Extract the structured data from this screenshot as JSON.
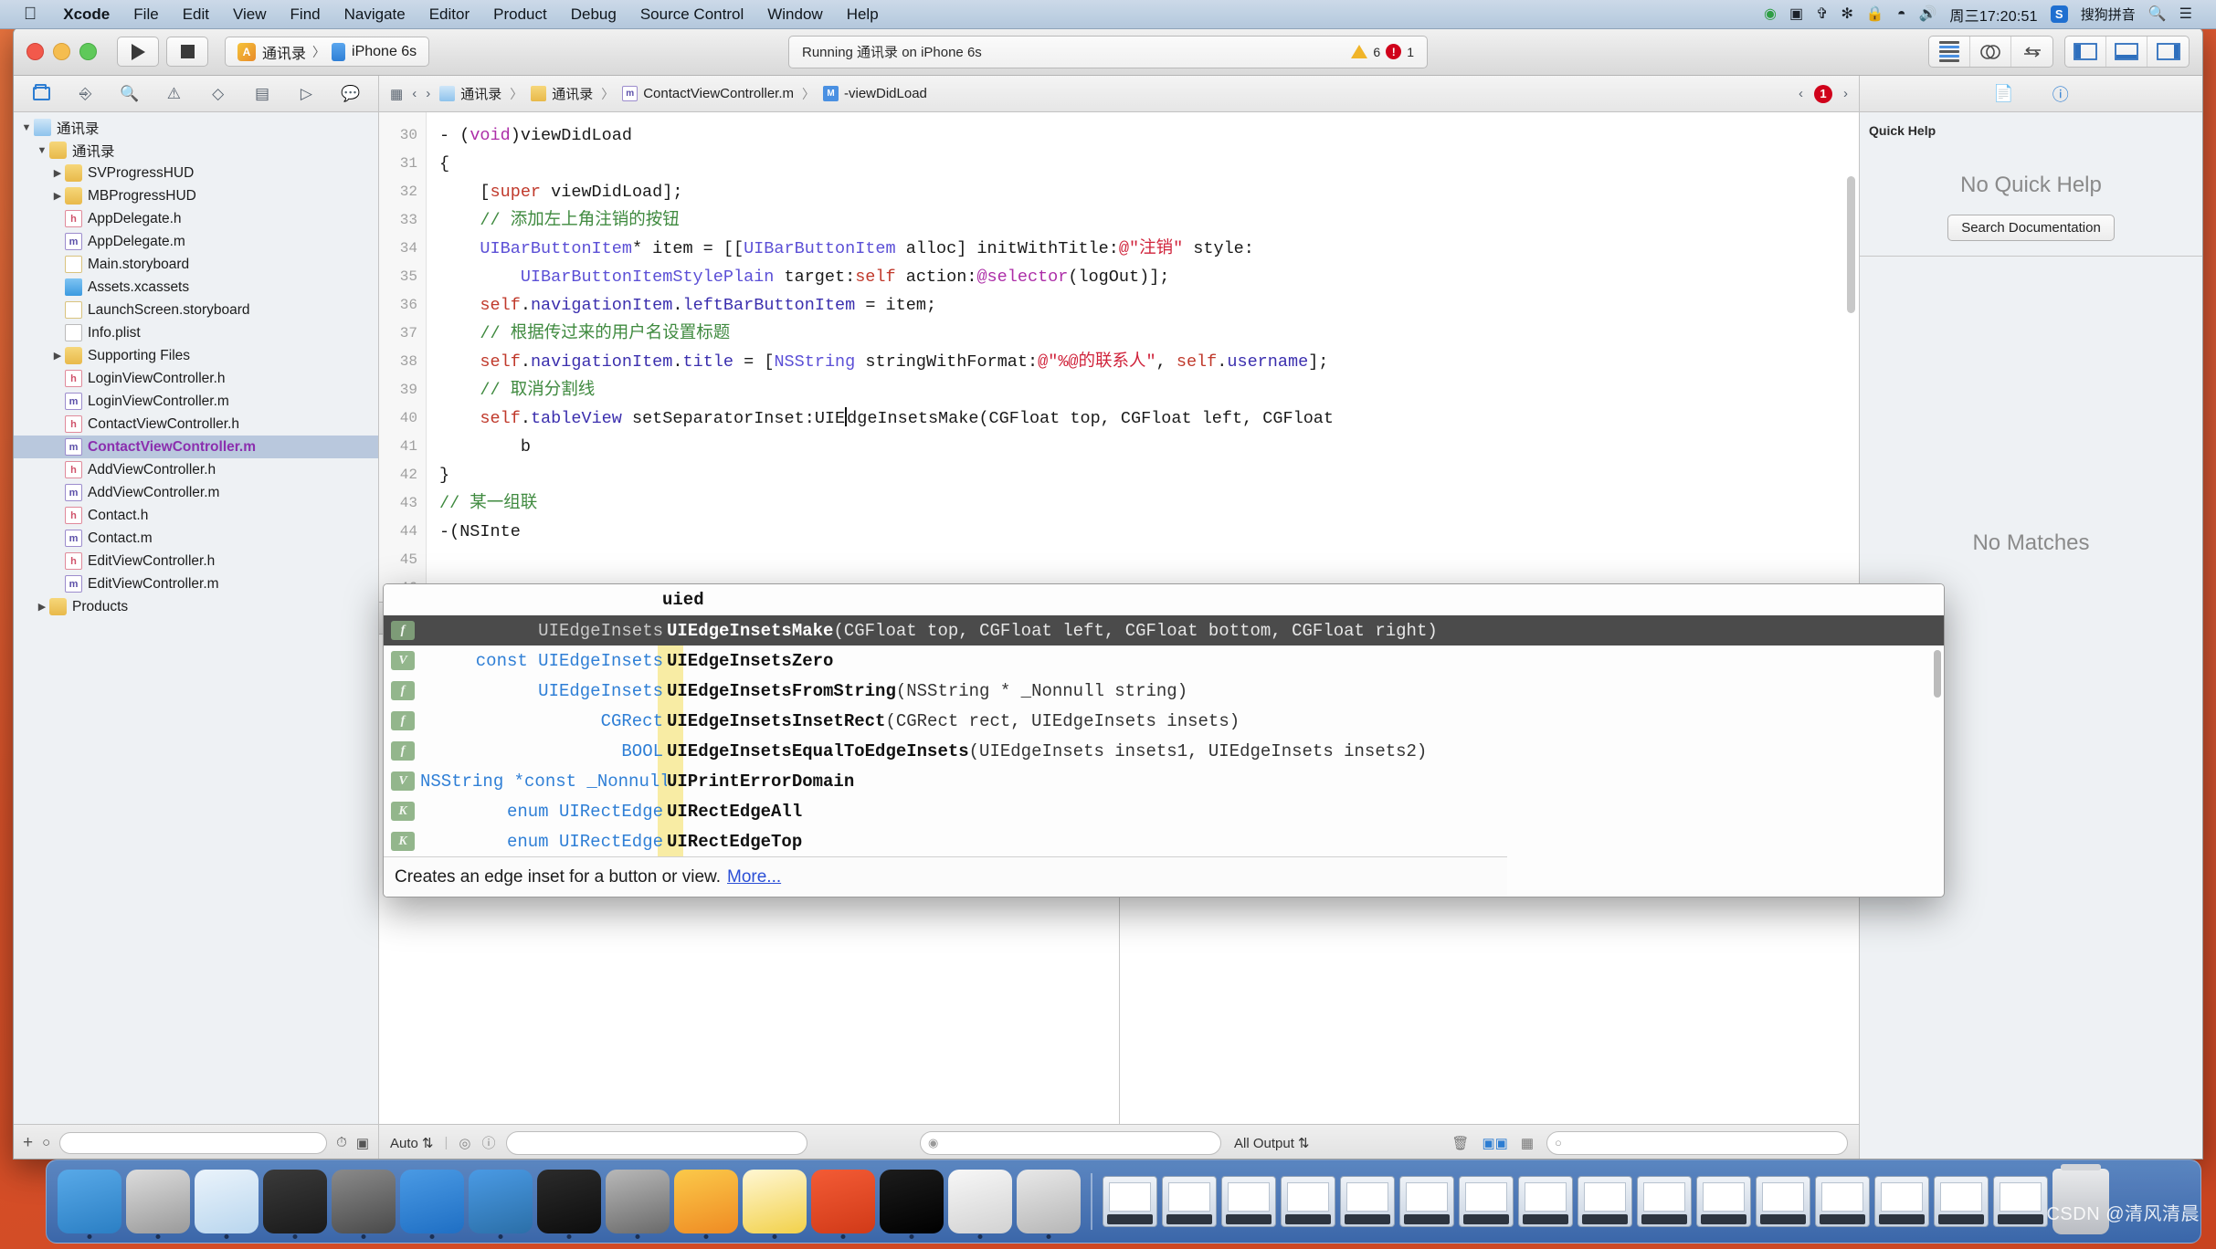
{
  "menubar": {
    "apple_icon": "apple-icon",
    "items": [
      {
        "label": "Xcode",
        "bold": true
      },
      {
        "label": "File",
        "bold": false
      },
      {
        "label": "Edit",
        "bold": false
      },
      {
        "label": "View",
        "bold": false
      },
      {
        "label": "Find",
        "bold": false
      },
      {
        "label": "Navigate",
        "bold": false
      },
      {
        "label": "Editor",
        "bold": false
      },
      {
        "label": "Product",
        "bold": false
      },
      {
        "label": "Debug",
        "bold": false
      },
      {
        "label": "Source Control",
        "bold": false
      },
      {
        "label": "Window",
        "bold": false
      },
      {
        "label": "Help",
        "bold": false
      }
    ],
    "status_icons": [
      "screen-record-icon",
      "airplay-icon",
      "dropbox-icon",
      "bluetooth-icon",
      "lock-icon",
      "wifi-icon",
      "volume-icon"
    ],
    "clock": "周三17:20:51",
    "input_method_badge": "S",
    "input_method_label": "搜狗拼音",
    "search_icon": "search-icon",
    "notification_icon": "notification-center-icon"
  },
  "toolbar": {
    "run_button": "run-button",
    "stop_button": "stop-button",
    "scheme_name": "通讯录",
    "scheme_separator": "〉",
    "destination": "iPhone 6s",
    "status_text": "Running 通讯录 on iPhone 6s",
    "warning_count": "6",
    "error_count": "1",
    "editor_buttons": [
      "standard-editor",
      "assistant-editor",
      "version-editor"
    ],
    "view_buttons": [
      "toggle-navigator",
      "toggle-debug-area",
      "toggle-utilities"
    ]
  },
  "navigator": {
    "tabs": [
      "project-navigator",
      "source-control-navigator",
      "find-navigator",
      "issue-navigator",
      "test-navigator",
      "debug-navigator",
      "breakpoint-navigator",
      "report-navigator"
    ],
    "active_tab_index": 0,
    "tree": [
      {
        "label": "通讯录",
        "icon": "project-icon",
        "indent": 0,
        "disclosure": "open",
        "selected": false
      },
      {
        "label": "通讯录",
        "icon": "folder-icon",
        "indent": 1,
        "disclosure": "open",
        "selected": false
      },
      {
        "label": "SVProgressHUD",
        "icon": "folder-icon",
        "indent": 2,
        "disclosure": "closed",
        "selected": false
      },
      {
        "label": "MBProgressHUD",
        "icon": "folder-icon",
        "indent": 2,
        "disclosure": "closed",
        "selected": false
      },
      {
        "label": "AppDelegate.h",
        "icon": "header-file-icon",
        "indent": 2,
        "disclosure": "",
        "selected": false
      },
      {
        "label": "AppDelegate.m",
        "icon": "source-file-icon",
        "indent": 2,
        "disclosure": "",
        "selected": false
      },
      {
        "label": "Main.storyboard",
        "icon": "storyboard-icon",
        "indent": 2,
        "disclosure": "",
        "selected": false
      },
      {
        "label": "Assets.xcassets",
        "icon": "assets-icon",
        "indent": 2,
        "disclosure": "",
        "selected": false
      },
      {
        "label": "LaunchScreen.storyboard",
        "icon": "storyboard-icon",
        "indent": 2,
        "disclosure": "",
        "selected": false
      },
      {
        "label": "Info.plist",
        "icon": "plist-icon",
        "indent": 2,
        "disclosure": "",
        "selected": false
      },
      {
        "label": "Supporting Files",
        "icon": "folder-icon",
        "indent": 2,
        "disclosure": "closed",
        "selected": false
      },
      {
        "label": "LoginViewController.h",
        "icon": "header-file-icon",
        "indent": 2,
        "disclosure": "",
        "selected": false
      },
      {
        "label": "LoginViewController.m",
        "icon": "source-file-icon",
        "indent": 2,
        "disclosure": "",
        "selected": false
      },
      {
        "label": "ContactViewController.h",
        "icon": "header-file-icon",
        "indent": 2,
        "disclosure": "",
        "selected": false
      },
      {
        "label": "ContactViewController.m",
        "icon": "source-file-icon",
        "indent": 2,
        "disclosure": "",
        "selected": true
      },
      {
        "label": "AddViewController.h",
        "icon": "header-file-icon",
        "indent": 2,
        "disclosure": "",
        "selected": false
      },
      {
        "label": "AddViewController.m",
        "icon": "source-file-icon",
        "indent": 2,
        "disclosure": "",
        "selected": false
      },
      {
        "label": "Contact.h",
        "icon": "header-file-icon",
        "indent": 2,
        "disclosure": "",
        "selected": false
      },
      {
        "label": "Contact.m",
        "icon": "source-file-icon",
        "indent": 2,
        "disclosure": "",
        "selected": false
      },
      {
        "label": "EditViewController.h",
        "icon": "header-file-icon",
        "indent": 2,
        "disclosure": "",
        "selected": false
      },
      {
        "label": "EditViewController.m",
        "icon": "source-file-icon",
        "indent": 2,
        "disclosure": "",
        "selected": false
      },
      {
        "label": "Products",
        "icon": "folder-icon",
        "indent": 1,
        "disclosure": "closed",
        "selected": false
      }
    ],
    "filter_placeholder": ""
  },
  "jumpbar": {
    "related_files_icon": "related-files-icon",
    "back_icon": "‹",
    "forward_icon": "›",
    "crumbs": [
      {
        "label": "通讯录",
        "icon": "project-icon"
      },
      {
        "label": "通讯录",
        "icon": "folder-icon"
      },
      {
        "label": "ContactViewController.m",
        "icon": "source-file-icon"
      },
      {
        "label": "-viewDidLoad",
        "icon": "method-icon"
      }
    ],
    "issue_prev": "‹",
    "issue_count": "1",
    "issue_next": "›"
  },
  "code": {
    "first_line_number": 30,
    "lines": [
      {
        "n": "30",
        "segments": [
          {
            "t": "- (",
            "c": "plain"
          },
          {
            "t": "void",
            "c": "kw"
          },
          {
            "t": ")viewDidLoad",
            "c": "plain"
          }
        ]
      },
      {
        "n": "31",
        "segments": [
          {
            "t": "{",
            "c": "plain"
          }
        ]
      },
      {
        "n": "32",
        "segments": [
          {
            "t": "    [",
            "c": "plain"
          },
          {
            "t": "super",
            "c": "kw2"
          },
          {
            "t": " viewDidLoad];",
            "c": "plain"
          }
        ]
      },
      {
        "n": "33",
        "segments": [
          {
            "t": "",
            "c": "plain"
          }
        ]
      },
      {
        "n": "34",
        "segments": [
          {
            "t": "    // 添加左上角注销的按钮",
            "c": "cmt"
          }
        ]
      },
      {
        "n": "35",
        "segments": [
          {
            "t": "    ",
            "c": "plain"
          },
          {
            "t": "UIBarButtonItem",
            "c": "typ"
          },
          {
            "t": "* item = [[",
            "c": "plain"
          },
          {
            "t": "UIBarButtonItem",
            "c": "typ"
          },
          {
            "t": " alloc] initWithTitle:",
            "c": "plain"
          },
          {
            "t": "@\"注销\"",
            "c": "str"
          },
          {
            "t": " style:",
            "c": "plain"
          }
        ]
      },
      {
        "n": "",
        "segments": [
          {
            "t": "        ",
            "c": "plain"
          },
          {
            "t": "UIBarButtonItemStylePlain",
            "c": "typ"
          },
          {
            "t": " target:",
            "c": "plain"
          },
          {
            "t": "self",
            "c": "kw2"
          },
          {
            "t": " action:",
            "c": "plain"
          },
          {
            "t": "@selector",
            "c": "kw"
          },
          {
            "t": "(logOut)];",
            "c": "plain"
          }
        ]
      },
      {
        "n": "36",
        "segments": [
          {
            "t": "    ",
            "c": "plain"
          },
          {
            "t": "self",
            "c": "kw2"
          },
          {
            "t": ".",
            "c": "plain"
          },
          {
            "t": "navigationItem",
            "c": "prop"
          },
          {
            "t": ".",
            "c": "plain"
          },
          {
            "t": "leftBarButtonItem",
            "c": "prop"
          },
          {
            "t": " = item;",
            "c": "plain"
          }
        ]
      },
      {
        "n": "37",
        "segments": [
          {
            "t": "",
            "c": "plain"
          }
        ]
      },
      {
        "n": "38",
        "segments": [
          {
            "t": "    // 根据传过来的用户名设置标题",
            "c": "cmt"
          }
        ]
      },
      {
        "n": "39",
        "segments": [
          {
            "t": "    ",
            "c": "plain"
          },
          {
            "t": "self",
            "c": "kw2"
          },
          {
            "t": ".",
            "c": "plain"
          },
          {
            "t": "navigationItem",
            "c": "prop"
          },
          {
            "t": ".",
            "c": "plain"
          },
          {
            "t": "title",
            "c": "prop"
          },
          {
            "t": " = [",
            "c": "plain"
          },
          {
            "t": "NSString",
            "c": "typ"
          },
          {
            "t": " stringWithFormat:",
            "c": "plain"
          },
          {
            "t": "@\"%@的联系人\"",
            "c": "str"
          },
          {
            "t": ", ",
            "c": "plain"
          },
          {
            "t": "self",
            "c": "kw2"
          },
          {
            "t": ".",
            "c": "plain"
          },
          {
            "t": "username",
            "c": "prop"
          },
          {
            "t": "];",
            "c": "plain"
          }
        ]
      },
      {
        "n": "40",
        "segments": [
          {
            "t": "",
            "c": "plain"
          }
        ]
      },
      {
        "n": "41",
        "segments": [
          {
            "t": "    // 取消分割线",
            "c": "cmt"
          }
        ]
      },
      {
        "n": "42",
        "segments": [
          {
            "t": "    ",
            "c": "plain"
          },
          {
            "t": "self",
            "c": "kw2"
          },
          {
            "t": ".",
            "c": "plain"
          },
          {
            "t": "tableView",
            "c": "prop"
          },
          {
            "t": " setSeparatorInset:",
            "c": "plain"
          },
          {
            "t": "UIE",
            "c": "plain"
          },
          {
            "t": "|",
            "c": "caret"
          },
          {
            "t": "dgeInsetsMake(CGFloat top, CGFloat left, CGFloat",
            "c": "plain"
          }
        ]
      },
      {
        "n": "",
        "segments": [
          {
            "t": "        b",
            "c": "plain"
          }
        ]
      },
      {
        "n": "43",
        "segments": [
          {
            "t": "}",
            "c": "plain"
          }
        ]
      },
      {
        "n": "44",
        "segments": [
          {
            "t": "",
            "c": "plain"
          }
        ]
      },
      {
        "n": "45",
        "segments": [
          {
            "t": "// 某一组联",
            "c": "cmt"
          }
        ]
      },
      {
        "n": "46",
        "segments": [
          {
            "t": "-(NSInte",
            "c": "plain"
          }
        ]
      }
    ]
  },
  "autocomplete": {
    "typed_text": "uied",
    "rows": [
      {
        "kind": "f",
        "return_type": "UIEdgeInsets",
        "name": "UIEdgeInsetsMake",
        "args": "(CGFloat top, CGFloat left, CGFloat bottom, CGFloat right)",
        "active": true
      },
      {
        "kind": "V",
        "return_type": "const UIEdgeInsets",
        "name": "UIEdgeInsetsZero",
        "args": "",
        "active": false
      },
      {
        "kind": "f",
        "return_type": "UIEdgeInsets",
        "name": "UIEdgeInsetsFromString",
        "args": "(NSString * _Nonnull string)",
        "active": false
      },
      {
        "kind": "f",
        "return_type": "CGRect",
        "name": "UIEdgeInsetsInsetRect",
        "args": "(CGRect rect, UIEdgeInsets insets)",
        "active": false
      },
      {
        "kind": "f",
        "return_type": "BOOL",
        "name": "UIEdgeInsetsEqualToEdgeInsets",
        "args": "(UIEdgeInsets insets1, UIEdgeInsets insets2)",
        "active": false
      },
      {
        "kind": "V",
        "return_type": "NSString *const _Nonnull",
        "name": "UIPrintErrorDomain",
        "args": "",
        "active": false
      },
      {
        "kind": "K",
        "return_type": "enum UIRectEdge",
        "name": "UIRectEdgeAll",
        "args": "",
        "active": false
      },
      {
        "kind": "K",
        "return_type": "enum UIRectEdge",
        "name": "UIRectEdgeTop",
        "args": "",
        "active": false
      }
    ],
    "footer_text": "Creates an edge inset for a button or view.",
    "footer_link": "More..."
  },
  "debug_bar": {
    "icons": [
      "hide-debug-icon",
      "continue-icon",
      "pause-icon",
      "step-over-icon",
      "step-into-icon",
      "step-out-icon"
    ]
  },
  "console_footer": {
    "scope_label": "Auto",
    "scope_chevron": "⇅",
    "left_icons": [
      "show-only-vars-icon",
      "info-icon"
    ],
    "search_placeholder": "",
    "output_label": "All Output",
    "output_chevron": "⇅",
    "trash_icon": "trash-icon",
    "split_icons": [
      "show-variables-view",
      "show-console-view"
    ],
    "grid_icon": "grid-icon",
    "filter_placeholder": ""
  },
  "utilities": {
    "tabs": [
      "file-inspector",
      "quick-help-inspector"
    ],
    "active_tab_index": 1,
    "section_title": "Quick Help",
    "empty_text": "No Quick Help",
    "button_label": "Search Documentation",
    "no_matches_text": "No Matches"
  },
  "dock": {
    "apps": [
      {
        "name": "finder-icon",
        "color1": "#58a9e8",
        "color2": "#2b7fc4"
      },
      {
        "name": "launchpad-icon",
        "color1": "#dcdcdc",
        "color2": "#9a9a9a"
      },
      {
        "name": "safari-icon",
        "color1": "#eaf3fb",
        "color2": "#b9d6ee"
      },
      {
        "name": "mouse-icon",
        "color1": "#3a3a3a",
        "color2": "#1a1a1a"
      },
      {
        "name": "quicktime-icon",
        "color1": "#8a8a8a",
        "color2": "#4a4a4a"
      },
      {
        "name": "xcode-icon",
        "color1": "#4a9ae4",
        "color2": "#1f6fc4"
      },
      {
        "name": "simulator-icon",
        "color1": "#4a9ae4",
        "color2": "#2b6fa8"
      },
      {
        "name": "terminal-icon",
        "color1": "#2b2b2b",
        "color2": "#0d0d0d"
      },
      {
        "name": "system-preferences-icon",
        "color1": "#b8b8b8",
        "color2": "#6a6a6a"
      },
      {
        "name": "sketch-icon",
        "color1": "#fbc94a",
        "color2": "#ef8b23"
      },
      {
        "name": "notes-icon",
        "color1": "#fff7d4",
        "color2": "#f2d14a"
      },
      {
        "name": "pcloud-icon",
        "color1": "#f35b35",
        "color2": "#d13a18"
      },
      {
        "name": "iterm-icon",
        "color1": "#1c1c1c",
        "color2": "#000000"
      },
      {
        "name": "pages-icon",
        "color1": "#f7f7f7",
        "color2": "#d2d2d2"
      },
      {
        "name": "chrome-icon",
        "color1": "#e8e8e8",
        "color2": "#b6b6b6"
      }
    ],
    "minimized_count": 16,
    "trash_icon": "trash-icon"
  },
  "watermark": "CSDN @清风清晨"
}
